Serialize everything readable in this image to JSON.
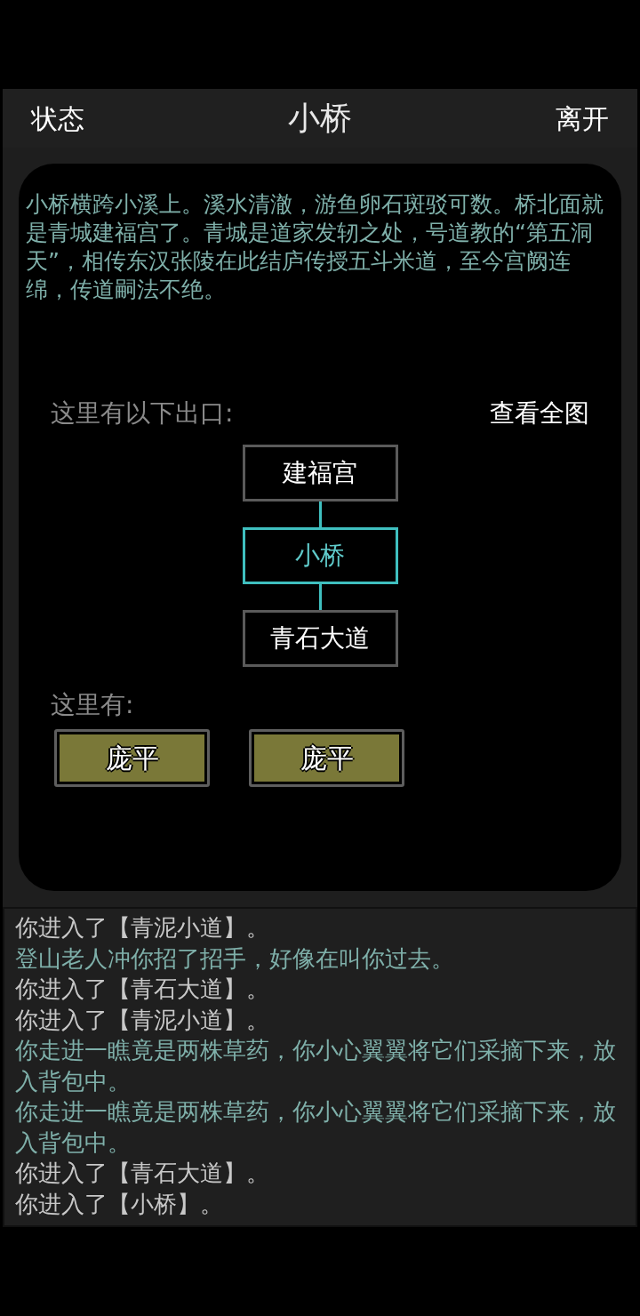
{
  "header": {
    "left_button": "状态",
    "title": "小桥",
    "right_button": "离开"
  },
  "description": "小桥横跨小溪上。溪水清澈，游鱼卵石斑驳可数。桥北面就是青城建福宫了。青城是道家发轫之处，号道教的“第五洞天”，相传东汉张陵在此结庐传授五斗米道，至今宫阙连绵，传道嗣法不绝。",
  "exits": {
    "label": "这里有以下出口:",
    "map_link": "查看全图",
    "nodes": [
      {
        "name": "建福宫",
        "selected": false
      },
      {
        "name": "小桥",
        "selected": true
      },
      {
        "name": "青石大道",
        "selected": false
      }
    ]
  },
  "people": {
    "label": "这里有:",
    "npcs": [
      "庞平",
      "庞平"
    ]
  },
  "log": [
    {
      "kind": "system",
      "text": "你进入了【青泥小道】。"
    },
    {
      "kind": "event",
      "text": "登山老人冲你招了招手，好像在叫你过去。"
    },
    {
      "kind": "system",
      "text": "你进入了【青石大道】。"
    },
    {
      "kind": "system",
      "text": "你进入了【青泥小道】。"
    },
    {
      "kind": "event",
      "text": "你走进一瞧竟是两株草药，你小心翼翼将它们采摘下来，放入背包中。"
    },
    {
      "kind": "event",
      "text": "你走进一瞧竟是两株草药，你小心翼翼将它们采摘下来，放入背包中。"
    },
    {
      "kind": "system",
      "text": "你进入了【青石大道】。"
    },
    {
      "kind": "system",
      "text": "你进入了【小桥】。"
    }
  ]
}
